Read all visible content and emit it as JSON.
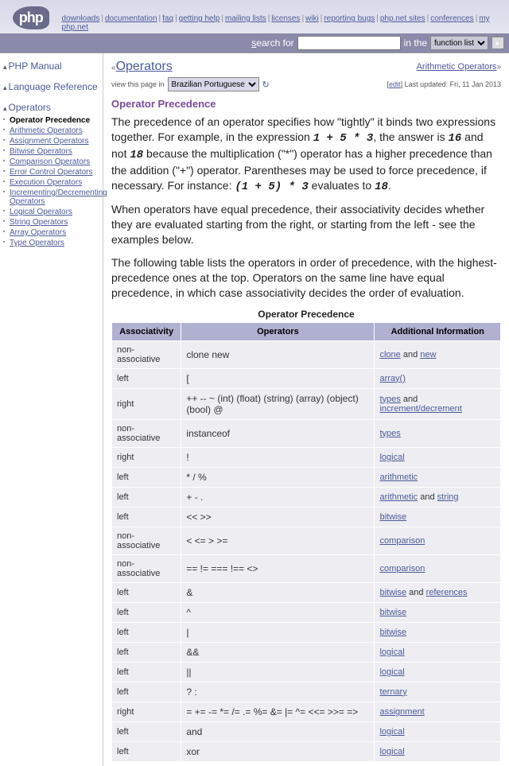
{
  "top_nav": {
    "items": [
      "downloads",
      "documentation",
      "faq",
      "getting help",
      "mailing lists",
      "licenses",
      "wiki",
      "reporting bugs",
      "php.net sites",
      "conferences",
      "my php.net"
    ]
  },
  "search": {
    "left": "search for",
    "in": "in the",
    "select": "function list"
  },
  "sidebar": {
    "sec1": "PHP Manual",
    "sec2": "Language Reference",
    "sec3": "Operators",
    "items": [
      "Operator Precedence",
      "Arithmetic Operators",
      "Assignment Operators",
      "Bitwise Operators",
      "Comparison Operators",
      "Error Control Operators",
      "Execution Operators",
      "Incrementing/Decrementing Operators",
      "Logical Operators",
      "String Operators",
      "Array Operators",
      "Type Operators"
    ]
  },
  "nav": {
    "prev": "Operators",
    "next": "Arithmetic Operators"
  },
  "lang": {
    "label": "view this page in",
    "select": "Brazilian Portuguese",
    "edit": "edit",
    "updated": "Last updated: Fri, 11 Jan 2013"
  },
  "title": "Operator Precedence",
  "para1": {
    "pre": "The precedence of an operator specifies how \"tightly\" it binds two expressions together. For example, in the expression ",
    "expr1": "1 + 5 * 3",
    "mid1": ", the answer is ",
    "n1": "16",
    "mid2": " and not ",
    "n2": "18",
    "post1": " because the multiplication (\"*\") operator has a higher precedence than the addition (\"+\") operator. Parentheses may be used to force precedence, if necessary. For instance: ",
    "expr2": "(1 + 5) * 3",
    "mid3": " evaluates to ",
    "n3": "18",
    "end": "."
  },
  "para2": "When operators have equal precedence, their associativity decides whether they are evaluated starting from the right, or starting from the left - see the examples below.",
  "para3": "The following table lists the operators in order of precedence, with the highest-precedence ones at the top. Operators on the same line have equal precedence, in which case associativity decides the order of evaluation.",
  "table": {
    "caption": "Operator Precedence",
    "h1": "Associativity",
    "h2": "Operators",
    "h3": "Additional Information",
    "rows": [
      {
        "a": "non-associative",
        "o": "clone new",
        "info": [
          {
            "t": "link",
            "v": "clone"
          },
          {
            "t": "txt",
            "v": " and "
          },
          {
            "t": "link",
            "v": "new"
          }
        ]
      },
      {
        "a": "left",
        "o": "[",
        "info": [
          {
            "t": "link",
            "v": "array()"
          }
        ]
      },
      {
        "a": "right",
        "o": "++ -- ~ (int) (float) (string) (array) (object) (bool) @",
        "info": [
          {
            "t": "link",
            "v": "types"
          },
          {
            "t": "txt",
            "v": " and "
          },
          {
            "t": "link",
            "v": "increment/decrement"
          }
        ]
      },
      {
        "a": "non-associative",
        "o": "instanceof",
        "info": [
          {
            "t": "link",
            "v": "types"
          }
        ]
      },
      {
        "a": "right",
        "o": "!",
        "info": [
          {
            "t": "link",
            "v": "logical"
          }
        ]
      },
      {
        "a": "left",
        "o": "* / %",
        "info": [
          {
            "t": "link",
            "v": "arithmetic"
          }
        ]
      },
      {
        "a": "left",
        "o": "+ - .",
        "info": [
          {
            "t": "link",
            "v": "arithmetic"
          },
          {
            "t": "txt",
            "v": " and "
          },
          {
            "t": "link",
            "v": "string"
          }
        ]
      },
      {
        "a": "left",
        "o": "<< >>",
        "info": [
          {
            "t": "link",
            "v": "bitwise"
          }
        ]
      },
      {
        "a": "non-associative",
        "o": "< <= > >=",
        "info": [
          {
            "t": "link",
            "v": "comparison"
          }
        ]
      },
      {
        "a": "non-associative",
        "o": "== != === !== <>",
        "info": [
          {
            "t": "link",
            "v": "comparison"
          }
        ]
      },
      {
        "a": "left",
        "o": "&",
        "info": [
          {
            "t": "link",
            "v": "bitwise"
          },
          {
            "t": "txt",
            "v": " and "
          },
          {
            "t": "link",
            "v": "references"
          }
        ]
      },
      {
        "a": "left",
        "o": "^",
        "info": [
          {
            "t": "link",
            "v": "bitwise"
          }
        ]
      },
      {
        "a": "left",
        "o": "|",
        "info": [
          {
            "t": "link",
            "v": "bitwise"
          }
        ]
      },
      {
        "a": "left",
        "o": "&&",
        "info": [
          {
            "t": "link",
            "v": "logical"
          }
        ]
      },
      {
        "a": "left",
        "o": "||",
        "info": [
          {
            "t": "link",
            "v": "logical"
          }
        ]
      },
      {
        "a": "left",
        "o": "? :",
        "info": [
          {
            "t": "link",
            "v": "ternary"
          }
        ]
      },
      {
        "a": "right",
        "o": "= += -= *= /= .= %= &= |= ^= <<= >>= =>",
        "info": [
          {
            "t": "link",
            "v": "assignment"
          }
        ]
      },
      {
        "a": "left",
        "o": "and",
        "info": [
          {
            "t": "link",
            "v": "logical"
          }
        ]
      },
      {
        "a": "left",
        "o": "xor",
        "info": [
          {
            "t": "link",
            "v": "logical"
          }
        ]
      }
    ]
  }
}
